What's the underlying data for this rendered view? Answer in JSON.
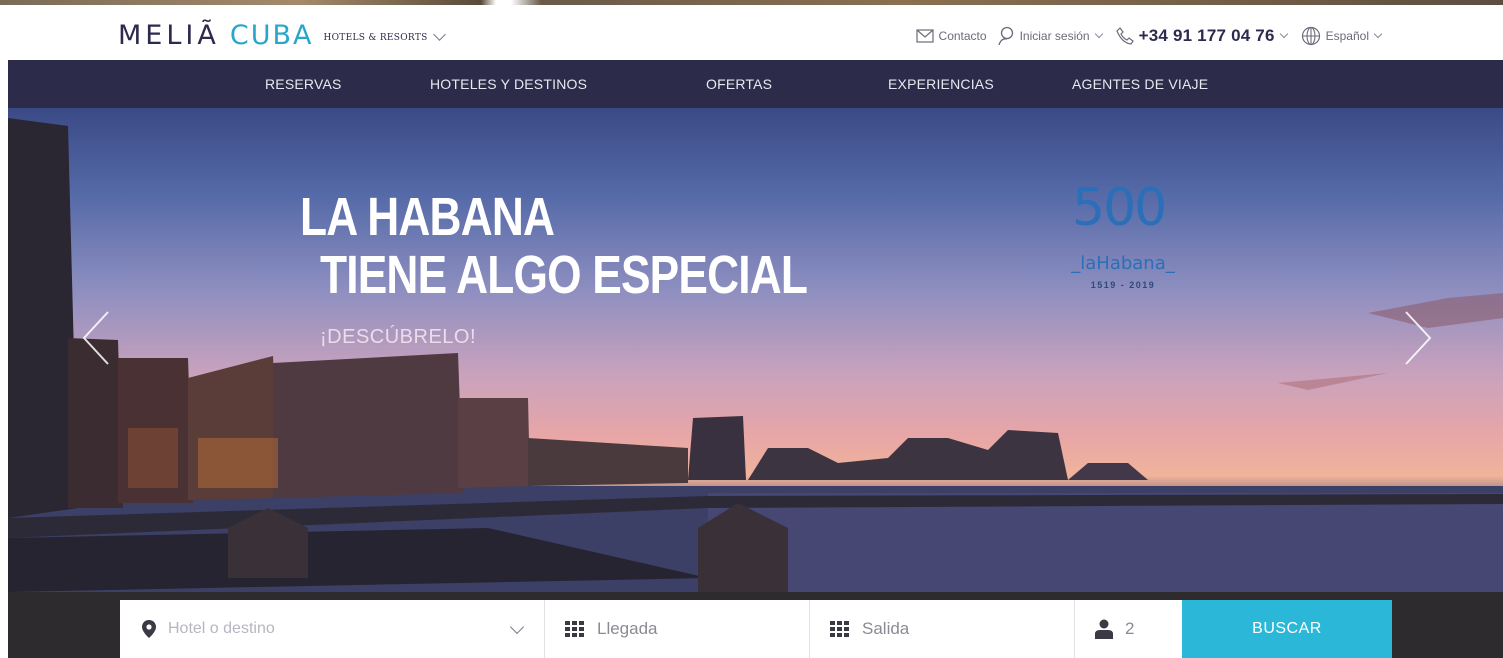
{
  "header": {
    "logo": {
      "brand": "MELIÃ",
      "brand2": "CUBA",
      "tagline": "HOTELS & RESORTS"
    },
    "contact_label": "Contacto",
    "login_label": "Iniciar sesión",
    "phone": "+34 91 177 04 76",
    "language": "Español"
  },
  "nav": {
    "items": [
      {
        "label": "RESERVAS"
      },
      {
        "label": "HOTELES Y DESTINOS"
      },
      {
        "label": "OFERTAS"
      },
      {
        "label": "EXPERIENCIAS"
      },
      {
        "label": "AGENTES DE VIAJE"
      }
    ]
  },
  "hero": {
    "title_line1": "LA HABANA",
    "title_line2": "TIENE ALGO ESPECIAL",
    "cta": "¡DESCÚBRELO!",
    "badge": {
      "number": "500",
      "city": "_laHabana_",
      "years": "1519 - 2019"
    }
  },
  "search": {
    "destination_placeholder": "Hotel o destino",
    "arrival_label": "Llegada",
    "departure_label": "Salida",
    "guests": "2",
    "button_label": "BUSCAR"
  },
  "colors": {
    "brand_dark": "#2d2b4a",
    "brand_cyan": "#2aa6c9",
    "button": "#2bb8d8"
  },
  "icons": [
    "envelope-icon",
    "user-icon",
    "phone-icon",
    "globe-icon",
    "map-pin-icon",
    "calendar-icon",
    "person-icon",
    "chevron-left-icon",
    "chevron-right-icon"
  ]
}
